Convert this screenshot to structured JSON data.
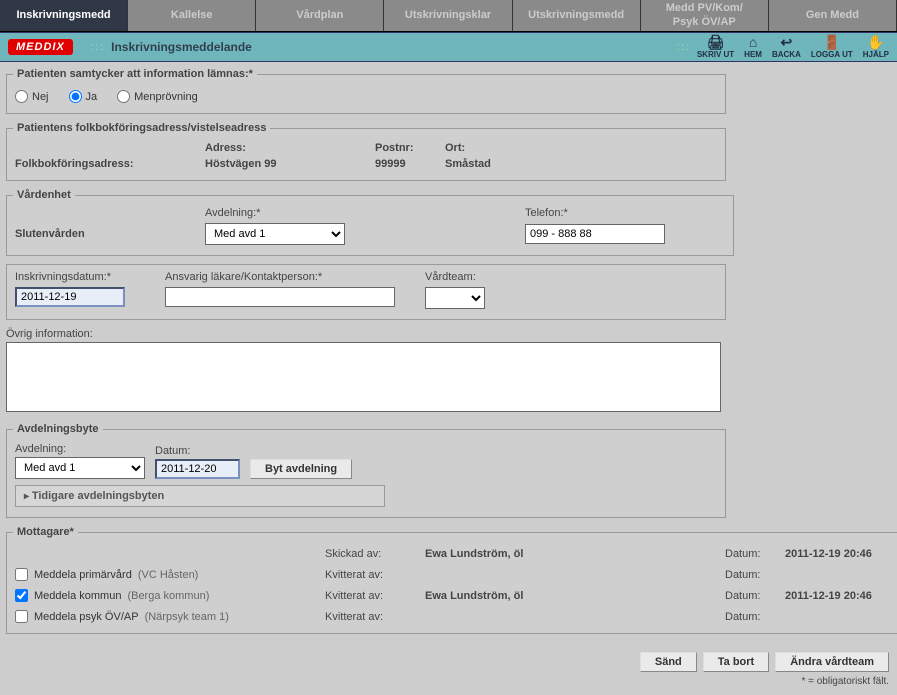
{
  "tabs": [
    {
      "label": "Inskrivningsmedd",
      "active": true
    },
    {
      "label": "Kallelse",
      "active": false
    },
    {
      "label": "Vårdplan",
      "active": false
    },
    {
      "label": "Utskrivningsklar",
      "active": false
    },
    {
      "label": "Utskrivningsmedd",
      "active": false
    },
    {
      "label": "Medd PV/Kom/\nPsyk ÖV/AP",
      "active": false
    },
    {
      "label": "Gen Medd",
      "active": false
    }
  ],
  "header": {
    "logo": "MEDDIX",
    "title": "Inskrivningsmeddelande",
    "actions": [
      {
        "name": "skriv-ut",
        "label": "SKRIV UT",
        "icon": "🖨"
      },
      {
        "name": "hem",
        "label": "HEM",
        "icon": "⌂"
      },
      {
        "name": "backa",
        "label": "BACKA",
        "icon": "↩"
      },
      {
        "name": "logga-ut",
        "label": "LOGGA UT",
        "icon": "🚪"
      },
      {
        "name": "hjalp",
        "label": "HJÄLP",
        "icon": "✋"
      }
    ]
  },
  "consent": {
    "legend": "Patienten samtycker att information lämnas:*",
    "options": [
      {
        "value": "nej",
        "label": "Nej",
        "checked": false
      },
      {
        "value": "ja",
        "label": "Ja",
        "checked": true
      },
      {
        "value": "men",
        "label": "Menprövning",
        "checked": false
      }
    ]
  },
  "address": {
    "legend": "Patientens folkbokföringsadress/vistelseadress",
    "row_label": "Folkbokföringsadress:",
    "h_adress": "Adress:",
    "h_postnr": "Postnr:",
    "h_ort": "Ort:",
    "v_adress": "Höstvägen 99",
    "v_postnr": "99999",
    "v_ort": "Småstad"
  },
  "ward": {
    "legend": "Vårdenhet",
    "unit_label": "Slutenvården",
    "avd_label": "Avdelning:*",
    "avd_value": "Med avd 1",
    "tel_label": "Telefon:*",
    "tel_value": "099 - 888 88"
  },
  "reg": {
    "date_label": "Inskrivningsdatum:*",
    "date_value": "2011-12-19",
    "doctor_label": "Ansvarig läkare/Kontaktperson:*",
    "doctor_value": "",
    "team_label": "Vårdteam:",
    "team_value": ""
  },
  "other": {
    "label": "Övrig information:",
    "value": ""
  },
  "wardchange": {
    "legend": "Avdelningsbyte",
    "avd_label": "Avdelning:",
    "avd_value": "Med avd 1",
    "date_label": "Datum:",
    "date_value": "2011-12-20",
    "button": "Byt avdelning",
    "expand": "Tidigare avdelningsbyten"
  },
  "recipients": {
    "legend": "Mottagare*",
    "col_skickad": "Skickad av:",
    "col_kvitterat": "Kvitterat av:",
    "col_datum": "Datum:",
    "rows": [
      {
        "type": "header",
        "chk": false,
        "chk_visible": false,
        "label": "",
        "who_lbl": "Skickad av:",
        "who": "Ewa Lundström, öl",
        "date": "2011-12-19 20:46"
      },
      {
        "type": "row",
        "chk": false,
        "chk_visible": true,
        "label": "Meddela primärvård",
        "paren": "(VC Håsten)",
        "who_lbl": "Kvitterat av:",
        "who": "",
        "date": ""
      },
      {
        "type": "row",
        "chk": true,
        "chk_visible": true,
        "label": "Meddela kommun",
        "paren": "(Berga kommun)",
        "who_lbl": "Kvitterat av:",
        "who": "Ewa Lundström, öl",
        "date": "2011-12-19 20:46"
      },
      {
        "type": "row",
        "chk": false,
        "chk_visible": true,
        "label": "Meddela psyk ÖV/AP",
        "paren": "(Närpsyk team 1)",
        "who_lbl": "Kvitterat av:",
        "who": "",
        "date": ""
      }
    ]
  },
  "buttons": {
    "send": "Sänd",
    "delete": "Ta bort",
    "changeteam": "Ändra vårdteam"
  },
  "footnote": "* = obligatoriskt fält."
}
